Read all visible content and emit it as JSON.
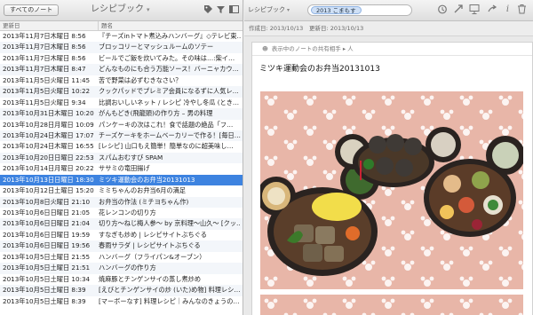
{
  "left": {
    "all_notes_label": "すべてのノート",
    "notebook_title": "レシピブック",
    "columns": {
      "updated": "更新日",
      "title": "題名"
    },
    "rows": [
      {
        "date": "2013年11月7日木曜日 8:56",
        "title": "『チーズinトマト煮込みハンバーグ』◇テレビ東…"
      },
      {
        "date": "2013年11月7日木曜日 8:56",
        "title": "ブロッコリーとマッシュルームのソテー"
      },
      {
        "date": "2013年11月7日木曜日 8:56",
        "title": "ビールでご飯を炊いてみた。その味は…:柴イ…"
      },
      {
        "date": "2013年11月7日木曜日 8:47",
        "title": "どんなものにも合う万能ソース！バーニャカウ…"
      },
      {
        "date": "2013年11月5日火曜日 11:45",
        "title": "苦で野菜は必ずむきなさい？"
      },
      {
        "date": "2013年11月5日火曜日 10:22",
        "title": "クックパッドでプレミア会員になるずに人気レ…"
      },
      {
        "date": "2013年11月5日火曜日 9:34",
        "title": "比調おいしいネット / レシピ 冷やし冬瓜 (とき…"
      },
      {
        "date": "2013年10月31日木曜日 10:20",
        "title": "がんもどき(飛龍頭)の作り方 – 男の料理"
      },
      {
        "date": "2013年10月28日月曜日 10:09",
        "title": "パンケーキの次はこれ！食で話題の絶品「フ…"
      },
      {
        "date": "2013年10月24日木曜日 17:07",
        "title": "チーズケーキをホームベーカリーで作る！[毎日…"
      },
      {
        "date": "2013年10月24日木曜日 16:55",
        "title": "[レシピ] 山口もえ簡単！簡単なのに超美味し…"
      },
      {
        "date": "2013年10月20日日曜日 22:53",
        "title": "スパムおむすび SPAM"
      },
      {
        "date": "2013年10月14日月曜日 20:22",
        "title": "ササミの竜田揚げ"
      },
      {
        "date": "2013年10月13日日曜日 18:30",
        "title": "ミツキ運動会のお弁当20131013"
      },
      {
        "date": "2013年10月12日土曜日 15:20",
        "title": "ミミちゃんのお弁当6月の満足"
      },
      {
        "date": "2013年10月8日火曜日 21:10",
        "title": "お弁当の作法 (ミチヨちゃん作)"
      },
      {
        "date": "2013年10月6日日曜日 21:05",
        "title": "花レンコンの切り方"
      },
      {
        "date": "2013年10月6日日曜日 21:04",
        "title": "切り方〜ねじ梅人参〜 by 京料理〜山久〜 [クッ…"
      },
      {
        "date": "2013年10月6日日曜日 19:59",
        "title": "すなぎも炒め | レシピサイトぶちぐる"
      },
      {
        "date": "2013年10月6日日曜日 19:56",
        "title": "春雨サラダ | レシピサイトぶちぐる"
      },
      {
        "date": "2013年10月5日土曜日 21:55",
        "title": "ハンバーグ（フライパン&オーブン）"
      },
      {
        "date": "2013年10月5日土曜日 21:51",
        "title": "ハンバーグの作り方"
      },
      {
        "date": "2013年10月5日土曜日 10:34",
        "title": "焼麻豚とチンゲンサイの蒸し煮炒め"
      },
      {
        "date": "2013年10月5日土曜日 8:39",
        "title": "[えびとチンゲンサイの炒 (いた)め物] 料理レシ…"
      },
      {
        "date": "2013年10月5日土曜日 8:39",
        "title": "[マーボーなす] 料理レシピ｜みんなのきょうの…"
      }
    ],
    "selected_index": 13
  },
  "right": {
    "notebook_label": "レシピブック",
    "tag_label": "2013 こまもす",
    "created": "作成日: 2013/10/13",
    "updated": "更新日: 2013/10/13",
    "share_text": "表示中のノートの共有相手 ▸ 人",
    "note_title": "ミツキ運動会のお弁当20131013"
  },
  "colors": {
    "selection": "#3d83e0",
    "tablecloth": "#e8b6a8",
    "toolbar": "#dedede"
  }
}
